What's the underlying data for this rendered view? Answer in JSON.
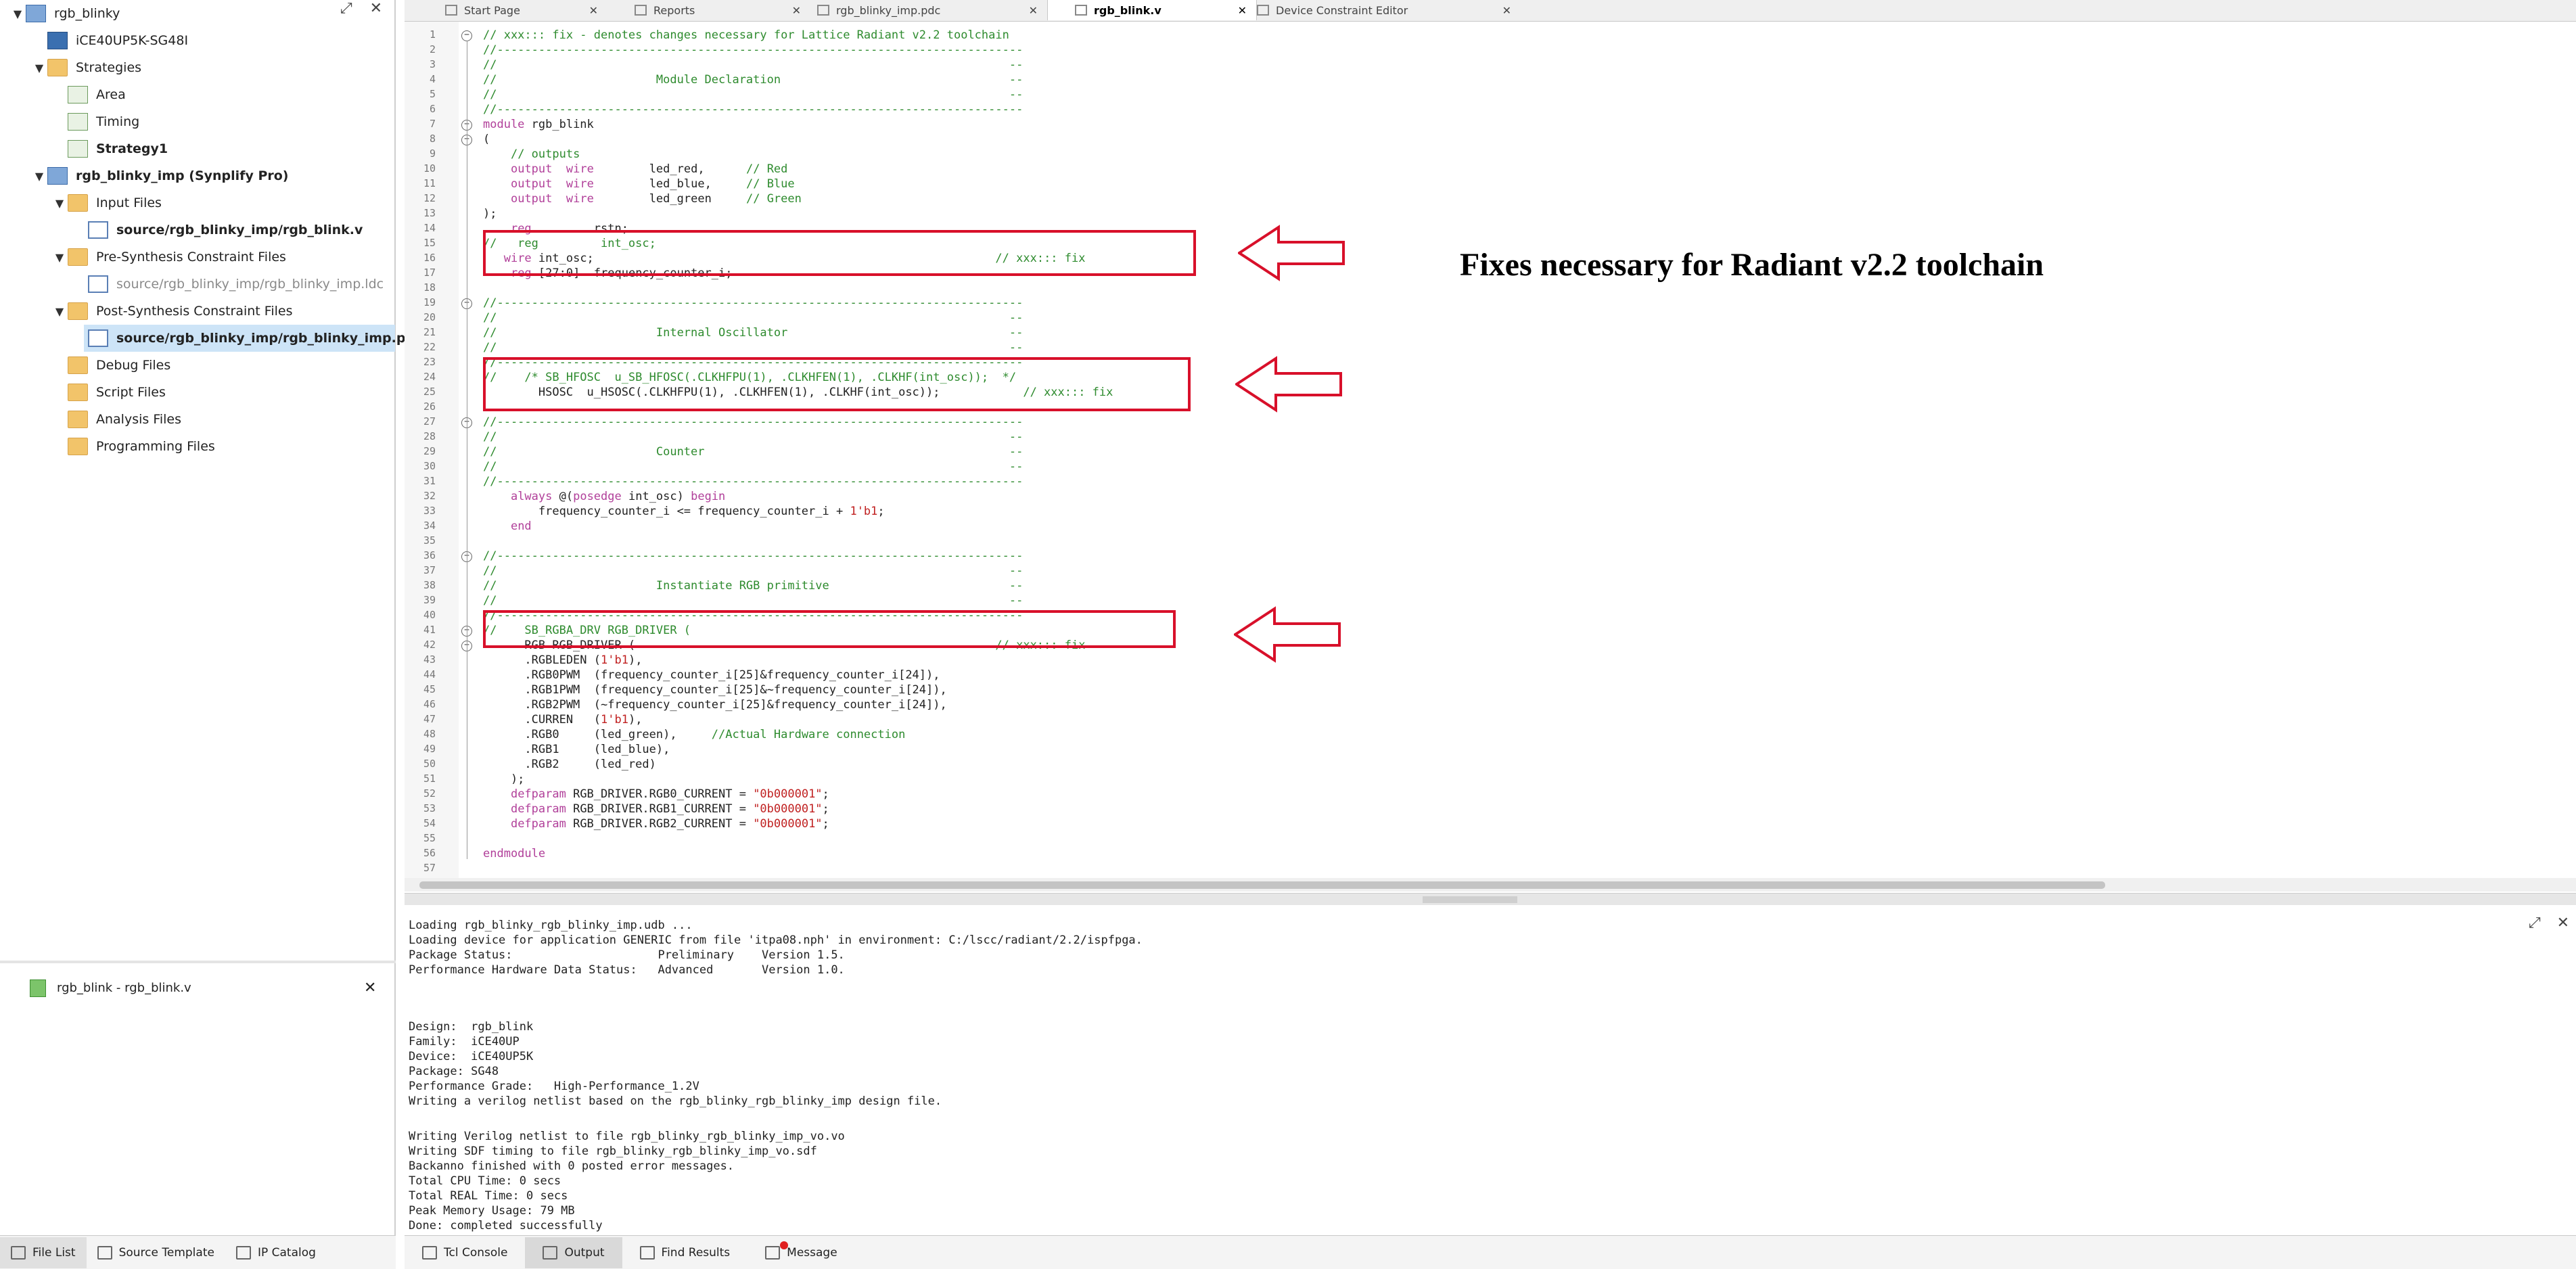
{
  "left_panel": {
    "tree": [
      {
        "label": "rgb_blinky",
        "type": "project",
        "level": 0,
        "expanded": true,
        "bold": false
      },
      {
        "label": "iCE40UP5K-SG48I",
        "type": "chip",
        "level": 1,
        "bold": false
      },
      {
        "label": "Strategies",
        "type": "folder",
        "level": 1,
        "expanded": true,
        "bold": false
      },
      {
        "label": "Area",
        "type": "strategy",
        "level": 2,
        "bold": false
      },
      {
        "label": "Timing",
        "type": "strategy",
        "level": 2,
        "bold": false
      },
      {
        "label": "Strategy1",
        "type": "strategy",
        "level": 2,
        "bold": true
      },
      {
        "label": "rgb_blinky_imp (Synplify Pro)",
        "type": "project",
        "level": 1,
        "expanded": true,
        "bold": true
      },
      {
        "label": "Input Files",
        "type": "folder",
        "level": 2,
        "expanded": true,
        "bold": false
      },
      {
        "label": "source/rgb_blinky_imp/rgb_blink.v",
        "type": "file",
        "level": 3,
        "bold": true
      },
      {
        "label": "Pre-Synthesis Constraint Files",
        "type": "folder",
        "level": 2,
        "expanded": true,
        "bold": false
      },
      {
        "label": "source/rgb_blinky_imp/rgb_blinky_imp.ldc",
        "type": "file",
        "level": 3,
        "bold": false,
        "grey": true
      },
      {
        "label": "Post-Synthesis Constraint Files",
        "type": "folder",
        "level": 2,
        "expanded": true,
        "bold": false
      },
      {
        "label": "source/rgb_blinky_imp/rgb_blinky_imp.pdc",
        "type": "file",
        "level": 3,
        "bold": true,
        "selected": true
      },
      {
        "label": "Debug Files",
        "type": "folder",
        "level": 2,
        "bold": false
      },
      {
        "label": "Script Files",
        "type": "folder",
        "level": 2,
        "bold": false
      },
      {
        "label": "Analysis Files",
        "type": "folder",
        "level": 2,
        "bold": false
      },
      {
        "label": "Programming Files",
        "type": "folder",
        "level": 2,
        "bold": false
      }
    ],
    "open_file": "rgb_blink - rgb_blink.v",
    "tabs": [
      "File List",
      "Source Template",
      "IP Catalog"
    ]
  },
  "editor_tabs": [
    {
      "label": "Start Page",
      "active": false
    },
    {
      "label": "Reports",
      "active": false
    },
    {
      "label": "rgb_blinky_imp.pdc",
      "active": false
    },
    {
      "label": "rgb_blink.v",
      "active": true
    },
    {
      "label": "Device Constraint Editor",
      "active": false
    }
  ],
  "code_lines": [
    "// xxx::: fix - denotes changes necessary for Lattice Radiant v2.2 toolchain",
    "//----------------------------------------------------------------------------",
    "//                                                                          --",
    "//                       Module Declaration                                 --",
    "//                                                                          --",
    "//----------------------------------------------------------------------------",
    "module rgb_blink",
    "(",
    "    // outputs",
    "    output  wire        led_red,      // Red",
    "    output  wire        led_blue,     // Blue",
    "    output  wire        led_green     // Green",
    ");",
    "    reg         rstn;",
    "//   reg         int_osc;",
    "   wire int_osc;                                                          // xxx::: fix",
    "    reg [27:0]  frequency_counter_i;",
    "",
    "//----------------------------------------------------------------------------",
    "//                                                                          --",
    "//                       Internal Oscillator                                --",
    "//                                                                          --",
    "//----------------------------------------------------------------------------",
    "//    /* SB_HFOSC  u_SB_HFOSC(.CLKHFPU(1), .CLKHFEN(1), .CLKHF(int_osc));  */",
    "        HSOSC  u_HSOSC(.CLKHFPU(1), .CLKHFEN(1), .CLKHF(int_osc));            // xxx::: fix",
    "",
    "//----------------------------------------------------------------------------",
    "//                                                                          --",
    "//                       Counter                                            --",
    "//                                                                          --",
    "//----------------------------------------------------------------------------",
    "    always @(posedge int_osc) begin",
    "        frequency_counter_i <= frequency_counter_i + 1'b1;",
    "    end",
    "",
    "//----------------------------------------------------------------------------",
    "//                                                                          --",
    "//                       Instantiate RGB primitive                          --",
    "//                                                                          --",
    "//----------------------------------------------------------------------------",
    "//    SB_RGBA_DRV RGB_DRIVER (",
    "      RGB RGB_DRIVER (                                                    // xxx::: fix",
    "      .RGBLEDEN (1'b1),",
    "      .RGB0PWM  (frequency_counter_i[25]&frequency_counter_i[24]),",
    "      .RGB1PWM  (frequency_counter_i[25]&~frequency_counter_i[24]),",
    "      .RGB2PWM  (~frequency_counter_i[25]&frequency_counter_i[24]),",
    "      .CURREN   (1'b1),",
    "      .RGB0     (led_green),     //Actual Hardware connection",
    "      .RGB1     (led_blue),",
    "      .RGB2     (led_red)",
    "    );",
    "    defparam RGB_DRIVER.RGB0_CURRENT = \"0b000001\";",
    "    defparam RGB_DRIVER.RGB1_CURRENT = \"0b000001\";",
    "    defparam RGB_DRIVER.RGB2_CURRENT = \"0b000001\";",
    "",
    "endmodule",
    ""
  ],
  "annotation": "Fixes necessary for Radiant v2.2 toolchain",
  "output_lines": [
    "Loading rgb_blinky_rgb_blinky_imp.udb ...",
    "Loading device for application GENERIC from file 'itpa08.nph' in environment: C:/lscc/radiant/2.2/ispfpga.",
    "Package Status:                     Preliminary    Version 1.5.",
    "Performance Hardware Data Status:   Advanced       Version 1.0.",
    "",
    "",
    "",
    "Design:  rgb_blink",
    "Family:  iCE40UP",
    "Device:  iCE40UP5K",
    "Package: SG48",
    "Performance Grade:   High-Performance_1.2V",
    "Writing a verilog netlist based on the rgb_blinky_rgb_blinky_imp design file.",
    "",
    "Writing Verilog netlist to file rgb_blinky_rgb_blinky_imp_vo.vo",
    "Writing SDF timing to file rgb_blinky_rgb_blinky_imp_vo.sdf",
    "Backanno finished with 0 posted error messages.",
    "Total CPU Time: 0 secs",
    "Total REAL Time: 0 secs",
    "Peak Memory Usage: 79 MB",
    "Done: completed successfully"
  ],
  "bottom_tabs": [
    {
      "label": "Tcl Console",
      "active": false
    },
    {
      "label": "Output",
      "active": true
    },
    {
      "label": "Find Results",
      "active": false
    },
    {
      "label": "Message",
      "active": false,
      "badge": true
    }
  ],
  "colors": {
    "accent_red": "#d8102a",
    "selection": "#cde4f7",
    "comment": "#2e8b2e",
    "keyword": "#b1409a"
  }
}
